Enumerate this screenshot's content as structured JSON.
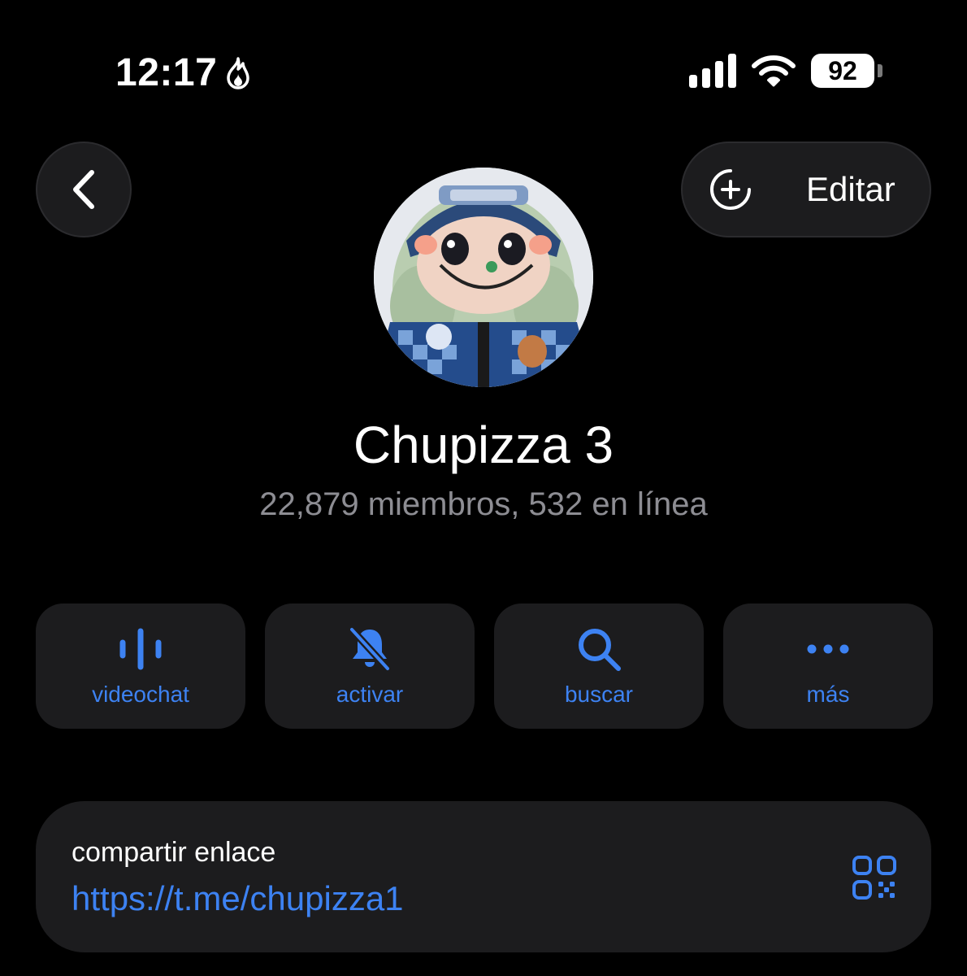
{
  "status_bar": {
    "time": "12:17",
    "battery": "92",
    "icons": [
      "flame-icon",
      "signal-icon",
      "wifi-icon",
      "battery-icon"
    ]
  },
  "header": {
    "back_icon": "chevron-left-icon",
    "edit_label": "Editar",
    "edit_icon": "add-circle-icon"
  },
  "profile": {
    "name": "Chupizza 3",
    "subtitle": "22,879 miembros, 532 en línea"
  },
  "actions": [
    {
      "label": "videochat",
      "icon": "voice-wave-icon"
    },
    {
      "label": "activar",
      "icon": "bell-slash-icon"
    },
    {
      "label": "buscar",
      "icon": "search-icon"
    },
    {
      "label": "más",
      "icon": "ellipsis-icon"
    }
  ],
  "link": {
    "title": "compartir enlace",
    "url": "https://t.me/chupizza1",
    "qr_icon": "qr-code-icon"
  },
  "colors": {
    "background": "#000000",
    "card": "#1c1c1e",
    "accent": "#3d82f2",
    "secondary_text": "#8d8d93"
  }
}
